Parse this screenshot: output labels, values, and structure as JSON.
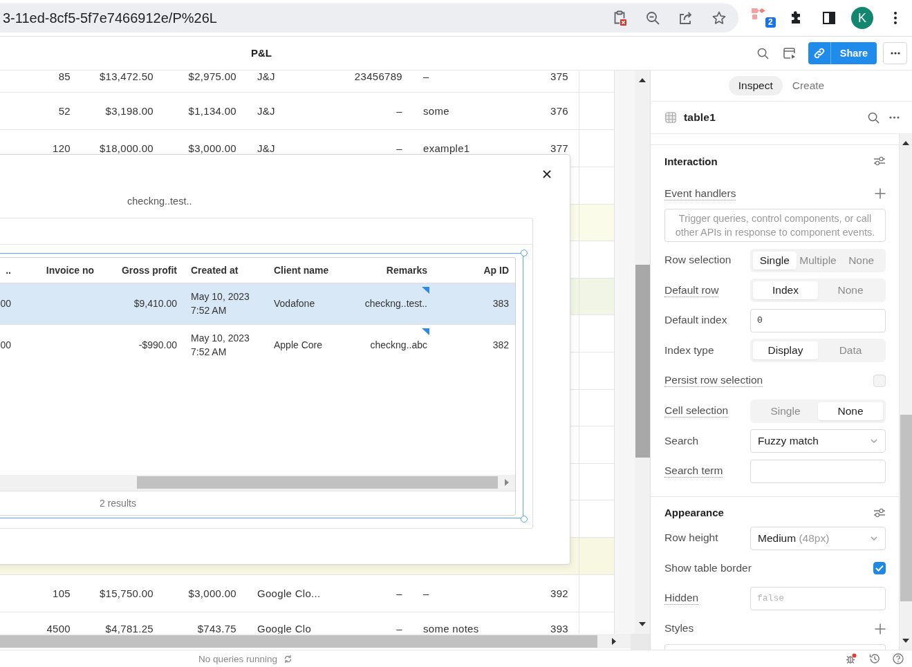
{
  "browser": {
    "url": "3-11ed-8cf5-5f7e7466912e/P%26L",
    "extension_badge": "2",
    "profile_initial": "K"
  },
  "app_header": {
    "title": "P&L",
    "share_button": "Share"
  },
  "canvas": {
    "table": {
      "rows": [
        {
          "color": "#ffffff",
          "cells": [
            "85",
            "$13,472.50",
            "$2,975.00",
            "J&J",
            "23456789",
            "–",
            "375"
          ]
        },
        {
          "color": "#ffffff",
          "cells": [
            "52",
            "$3,198.00",
            "$1,134.00",
            "J&J",
            "–",
            "some",
            "376"
          ]
        },
        {
          "color": "#ffffff",
          "cells": [
            "120",
            "$18,000.00",
            "$3,000.00",
            "J&J",
            "–",
            "example1",
            "377"
          ]
        },
        {
          "color": "#ffffff"
        },
        {
          "color": "#fbfbe9"
        },
        {
          "color": "#ffffff"
        },
        {
          "color": "#f0f5e6"
        },
        {
          "color": "#ffffff"
        },
        {
          "color": "#ffffff"
        },
        {
          "color": "#ffffff"
        },
        {
          "color": "#ffffff"
        },
        {
          "color": "#ffffff"
        },
        {
          "color": "#ffffff"
        },
        {
          "color": "#f8f8e2"
        },
        {
          "color": "#ffffff",
          "cells": [
            "105",
            "$15,750.00",
            "$3,000.00",
            "Google Clo...",
            "–",
            "–",
            "392"
          ]
        },
        {
          "color": "#ffffff",
          "cells": [
            "4500",
            "$4,781.25",
            "$743.75",
            "Google Clo",
            "–",
            "some notes",
            "393"
          ]
        }
      ]
    },
    "modal": {
      "text": "checkng..test..",
      "table": {
        "columns": [
          "..",
          "Invoice no",
          "Gross profit",
          "Created at",
          "Client name",
          "Remarks",
          "Ap ID"
        ],
        "rows": [
          {
            "selected": true,
            "column_1": "00",
            "gross_profit": "$9,410.00",
            "created_at": "May 10, 2023\n7:52 AM",
            "client_name": "Vodafone",
            "remarks": "checkng..test..",
            "ap_id": "383"
          },
          {
            "selected": false,
            "column_1": "00",
            "gross_profit": "-$990.00",
            "created_at": "May 10, 2023\n7:52 AM",
            "client_name": "Apple Core",
            "remarks": "checkng..abc",
            "ap_id": "382"
          }
        ],
        "footer": "2 results"
      }
    }
  },
  "inspector": {
    "tabs": [
      {
        "label": "Inspect",
        "selected": true
      },
      {
        "label": "Create",
        "selected": false
      }
    ],
    "component": "table1",
    "sections": [
      {
        "title": "Interaction",
        "items": [
          {
            "kind": "list",
            "label": "Event handlers",
            "dotted_underline": true,
            "hint": "Trigger queries, control components, or call other APIs in response to component events."
          },
          {
            "kind": "segmented",
            "label": "Row selection",
            "dotted_underline": false,
            "options": [
              {
                "label": "Single",
                "selected": true
              },
              {
                "label": "Multiple",
                "selected": false
              },
              {
                "label": "None",
                "selected": false
              }
            ]
          },
          {
            "kind": "segmented",
            "label": "Default row",
            "dotted_underline": true,
            "options": [
              {
                "label": "Index",
                "selected": true
              },
              {
                "label": "None",
                "selected": false
              }
            ]
          },
          {
            "kind": "input",
            "label": "Default index",
            "dotted_underline": false,
            "value": "0"
          },
          {
            "kind": "segmented",
            "label": "Index type",
            "dotted_underline": false,
            "options": [
              {
                "label": "Display",
                "selected": true
              },
              {
                "label": "Data",
                "selected": false
              }
            ]
          },
          {
            "kind": "checkbox",
            "label": "Persist row selection",
            "dotted_underline": true,
            "checked": false
          },
          {
            "kind": "segmented",
            "label": "Cell selection",
            "dotted_underline": true,
            "options": [
              {
                "label": "Single",
                "selected": false
              },
              {
                "label": "None",
                "selected": true
              }
            ]
          },
          {
            "kind": "select",
            "label": "Search",
            "dotted_underline": false,
            "value": "Fuzzy match"
          },
          {
            "kind": "input",
            "label": "Search term",
            "dotted_underline": true
          }
        ]
      },
      {
        "title": "Appearance",
        "items": [
          {
            "kind": "select",
            "label": "Row height",
            "dotted_underline": false,
            "value": "Medium",
            "hint": "(48px)"
          },
          {
            "kind": "checkbox",
            "label": "Show table border",
            "dotted_underline": false,
            "checked": true
          },
          {
            "kind": "input",
            "label": "Hidden",
            "dotted_underline": true,
            "placeholder": "false"
          },
          {
            "kind": "list",
            "label": "Styles",
            "dotted_underline": false
          }
        ]
      }
    ]
  },
  "status_bar": {
    "text": "No queries running"
  }
}
